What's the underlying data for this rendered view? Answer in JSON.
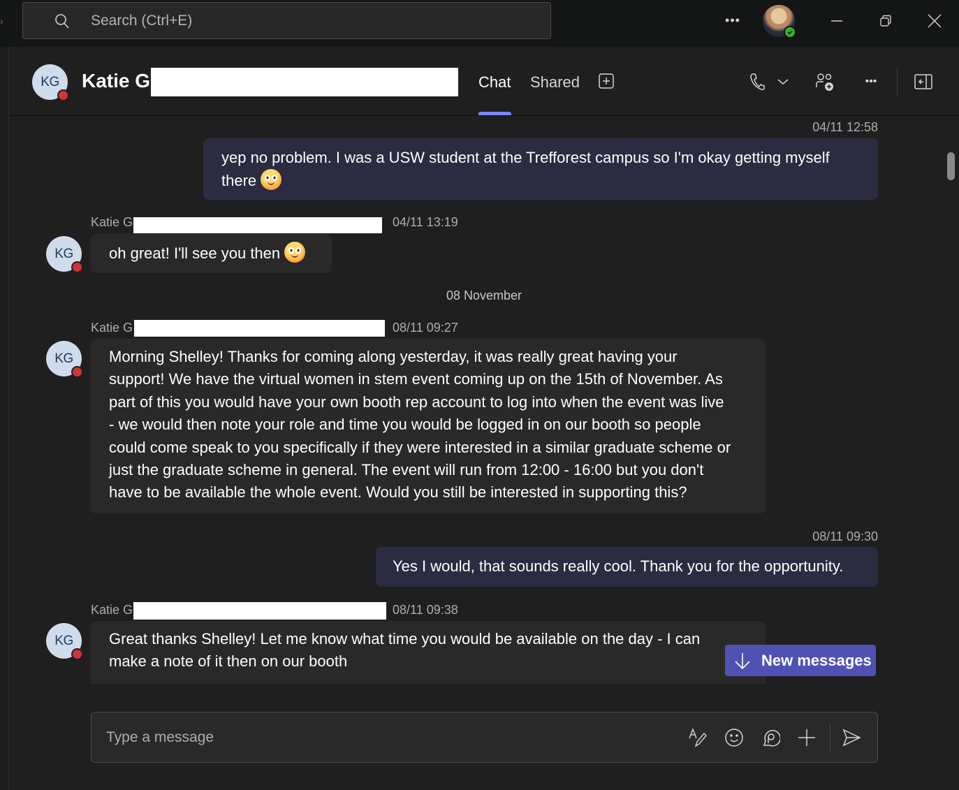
{
  "titlebar": {
    "search_placeholder": "Search (Ctrl+E)",
    "more_label": "•••",
    "user_status": "available",
    "status_color": "#2fb52e"
  },
  "header": {
    "avatar_initials": "KG",
    "contact_name": "Katie G",
    "presence_color": "#d13438",
    "tabs": [
      {
        "label": "Chat",
        "active": true
      },
      {
        "label": "Shared",
        "active": false
      }
    ],
    "accent_color": "#7f85f5",
    "icons": [
      "add-tab-icon",
      "phone-icon",
      "chevron-down-icon",
      "add-people-icon",
      "more-options-icon",
      "open-side-panel-icon"
    ],
    "more_label": "•••"
  },
  "messages": [
    {
      "from": "me",
      "timestamp": "04/11 12:58",
      "text": "yep no problem.  I was a USW student at the Trefforest campus so I'm okay getting myself",
      "text_line2": "there",
      "emoji": "smiling-face"
    },
    {
      "from": "them",
      "sender": "Katie G",
      "avatar_initials": "KG",
      "timestamp": "04/11 13:19",
      "text": "oh great! I'll see you then",
      "emoji": "smiling-face"
    },
    {
      "type": "date-separator",
      "label": "08 November"
    },
    {
      "from": "them",
      "sender": "Katie G",
      "avatar_initials": "KG",
      "timestamp": "08/11 09:27",
      "lines": [
        "Morning Shelley! Thanks for coming along yesterday, it was really great having your",
        "support! We have the virtual women in stem event coming up on the 15th of November. As",
        "part of this you would have your own booth rep account to log into when the event was live",
        "- we would then note your role and time you would be logged in on our booth so people",
        "could come speak to you specifically if they were interested in a similar graduate scheme or",
        "just the graduate scheme in general. The event will run from 12:00 - 16:00 but you don't",
        "have to be available the whole event. Would you still be interested in supporting this?"
      ]
    },
    {
      "from": "me",
      "timestamp": "08/11 09:30",
      "text": "Yes I would, that sounds really cool.  Thank you for the opportunity."
    },
    {
      "from": "them",
      "sender": "Katie G",
      "avatar_initials": "KG",
      "timestamp": "08/11 09:38",
      "lines": [
        "Great thanks Shelley! Let me know what time you would be available on the day - I can",
        "make a note of it then on our booth"
      ]
    }
  ],
  "new_messages_button": {
    "label": "New messages",
    "color": "#4f52b2"
  },
  "composer": {
    "placeholder": "Type a message",
    "icons": [
      "format-icon",
      "emoji-icon",
      "loop-icon",
      "attach-plus-icon",
      "send-icon"
    ]
  }
}
